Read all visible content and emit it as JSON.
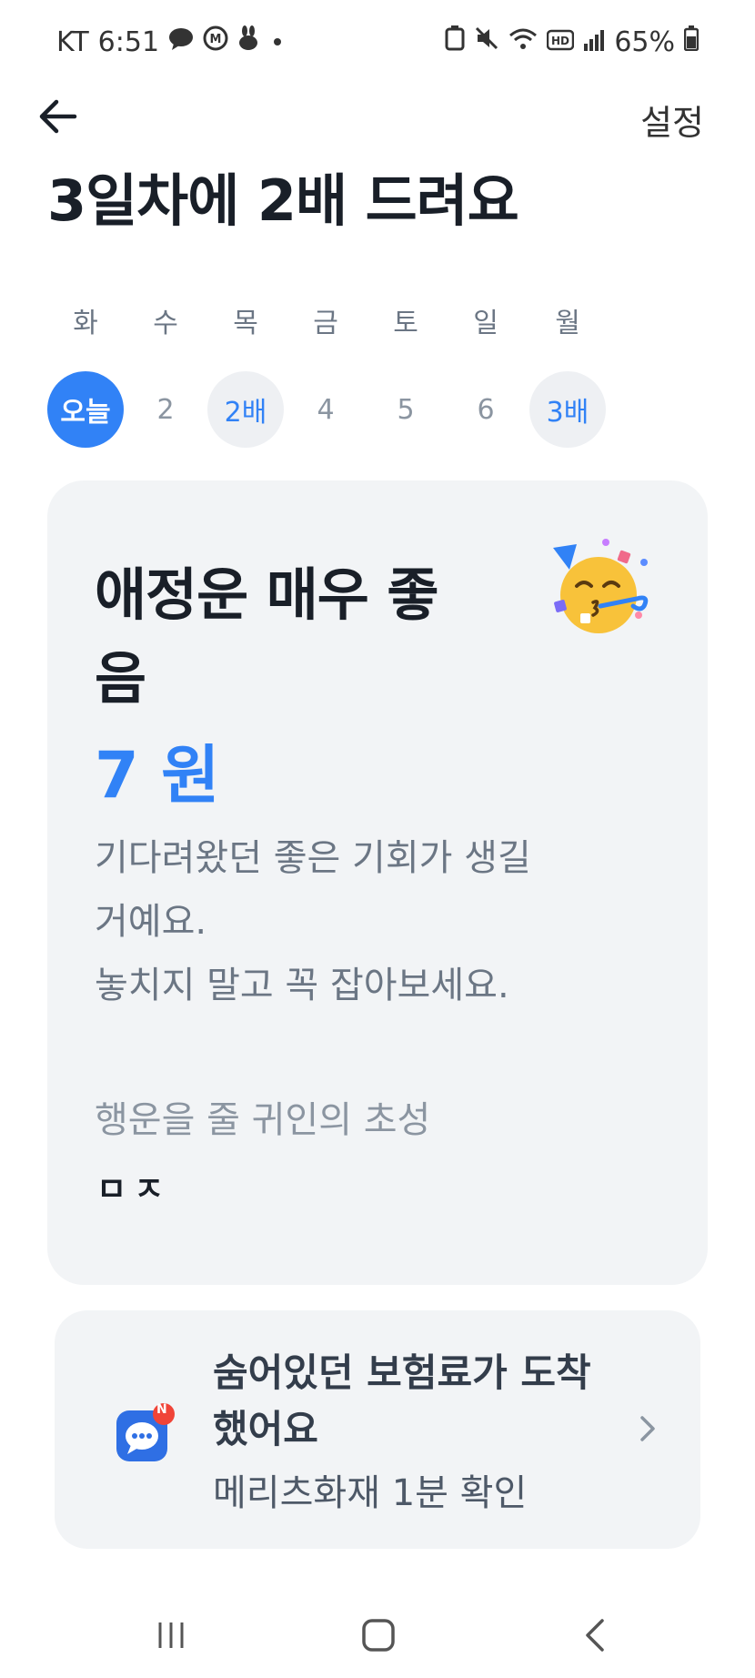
{
  "status_bar": {
    "carrier": "KT",
    "time": "6:51",
    "battery": "65%",
    "left_icons": [
      "chat-bubble-icon",
      "m-icon",
      "rabbit-icon",
      "dot-icon"
    ],
    "right_icons": [
      "battery-saver-icon",
      "mute-icon",
      "wifi-icon",
      "hd-icon",
      "signal-icon",
      "battery-icon"
    ]
  },
  "header": {
    "back_icon": "arrow-left-icon",
    "settings_label": "설정",
    "title": "3일차에 2배 드려요"
  },
  "week": {
    "days": [
      {
        "name": "화",
        "label": "오늘",
        "state": "today"
      },
      {
        "name": "수",
        "label": "2",
        "state": "normal"
      },
      {
        "name": "목",
        "label": "2배",
        "state": "bonus"
      },
      {
        "name": "금",
        "label": "4",
        "state": "normal"
      },
      {
        "name": "토",
        "label": "5",
        "state": "normal"
      },
      {
        "name": "일",
        "label": "6",
        "state": "normal"
      },
      {
        "name": "월",
        "label": "3배",
        "state": "bonus"
      }
    ]
  },
  "fortune": {
    "title": "애정운 매우 좋음",
    "amount": "7 원",
    "description": "기다려왔던 좋은 기회가 생길\n거예요.\n놓치지 말고 꼭 잡아보세요.",
    "lucky_label": "행운을 줄 귀인의 초성",
    "lucky_initials": "ㅁㅈ",
    "emoji_icon": "party-face-icon"
  },
  "ad": {
    "title": "숨어있던 보험료가 도착했어요",
    "subtitle": "메리츠화재 1분 확인",
    "icon": "message-chat-icon",
    "badge": "N"
  },
  "nav": {
    "icons": [
      "recent-apps-icon",
      "home-icon",
      "back-icon"
    ]
  },
  "colors": {
    "accent": "#3182f6",
    "card_bg": "#f2f4f6",
    "badge": "#f04438"
  }
}
